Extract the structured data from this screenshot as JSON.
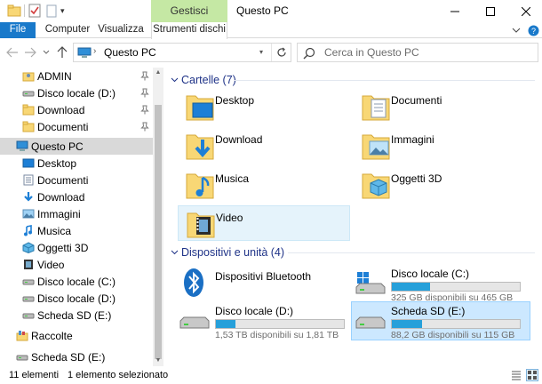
{
  "titlebar": {
    "contextual_group": "Gestisci",
    "title": "Questo PC",
    "qa_dropdown_glyph": "▾"
  },
  "ribbon": {
    "tabs": [
      {
        "label": "File"
      },
      {
        "label": "Computer"
      },
      {
        "label": "Visualizza"
      },
      {
        "label": "Strumenti dischi"
      }
    ]
  },
  "address": {
    "path_separator": "›",
    "path": "Questo PC",
    "dropdown_glyph": "▾",
    "search_placeholder": "Cerca in Questo PC"
  },
  "navpane": {
    "quick_access": [
      {
        "label": "ADMIN",
        "icon": "user-folder-icon",
        "pinned": true
      },
      {
        "label": "Disco locale (D:)",
        "icon": "drive-icon",
        "pinned": true
      },
      {
        "label": "Download",
        "icon": "folder-icon",
        "pinned": true
      },
      {
        "label": "Documenti",
        "icon": "folder-icon",
        "pinned": true
      }
    ],
    "this_pc": {
      "label": "Questo PC",
      "icon": "computer-icon"
    },
    "this_pc_children": [
      {
        "label": "Desktop",
        "icon": "desktop-folder-icon"
      },
      {
        "label": "Documenti",
        "icon": "documents-folder-icon"
      },
      {
        "label": "Download",
        "icon": "download-folder-icon"
      },
      {
        "label": "Immagini",
        "icon": "pictures-folder-icon"
      },
      {
        "label": "Musica",
        "icon": "music-folder-icon"
      },
      {
        "label": "Oggetti 3D",
        "icon": "objects-3d-icon"
      },
      {
        "label": "Video",
        "icon": "video-folder-icon"
      },
      {
        "label": "Disco locale (C:)",
        "icon": "drive-icon"
      },
      {
        "label": "Disco locale (D:)",
        "icon": "drive-icon"
      },
      {
        "label": "Scheda SD (E:)",
        "icon": "drive-icon"
      }
    ],
    "raccolte": {
      "label": "Raccolte",
      "icon": "libraries-icon"
    },
    "sd_card": {
      "label": "Scheda SD (E:)",
      "icon": "drive-icon"
    }
  },
  "content": {
    "folders_header": "Cartelle (7)",
    "folders": [
      {
        "label": "Desktop",
        "icon": "desktop-folder-icon"
      },
      {
        "label": "Documenti",
        "icon": "documents-folder-icon"
      },
      {
        "label": "Download",
        "icon": "download-folder-icon"
      },
      {
        "label": "Immagini",
        "icon": "pictures-folder-icon"
      },
      {
        "label": "Musica",
        "icon": "music-folder-icon"
      },
      {
        "label": "Oggetti 3D",
        "icon": "objects-3d-icon"
      },
      {
        "label": "Video",
        "icon": "video-folder-icon",
        "selected": true
      }
    ],
    "devices_header": "Dispositivi e unità (4)",
    "devices": [
      {
        "label": "Dispositivi Bluetooth",
        "icon": "bluetooth-icon"
      },
      {
        "label": "Disco locale (C:)",
        "icon": "windows-drive-icon",
        "free": "325 GB disponibili su 465 GB",
        "used_fraction": 0.3,
        "selected": false
      },
      {
        "label": "Disco locale (D:)",
        "icon": "drive-icon",
        "free": "1,53 TB disponibili su 1,81 TB",
        "used_fraction": 0.155,
        "selected": false
      },
      {
        "label": "Scheda SD (E:)",
        "icon": "drive-icon",
        "free": "88,2 GB disponibili su 115 GB",
        "used_fraction": 0.233,
        "selected": true
      }
    ]
  },
  "statusbar": {
    "count": "11 elementi",
    "selection": "1 elemento selezionato"
  },
  "colors": {
    "accent": "#1979ca",
    "group_header": "#1e3287",
    "drive_bar": "#26a0da",
    "selection": "#cce8ff",
    "contextual_tab": "#c5e8a4",
    "folder": "#f8d775"
  }
}
